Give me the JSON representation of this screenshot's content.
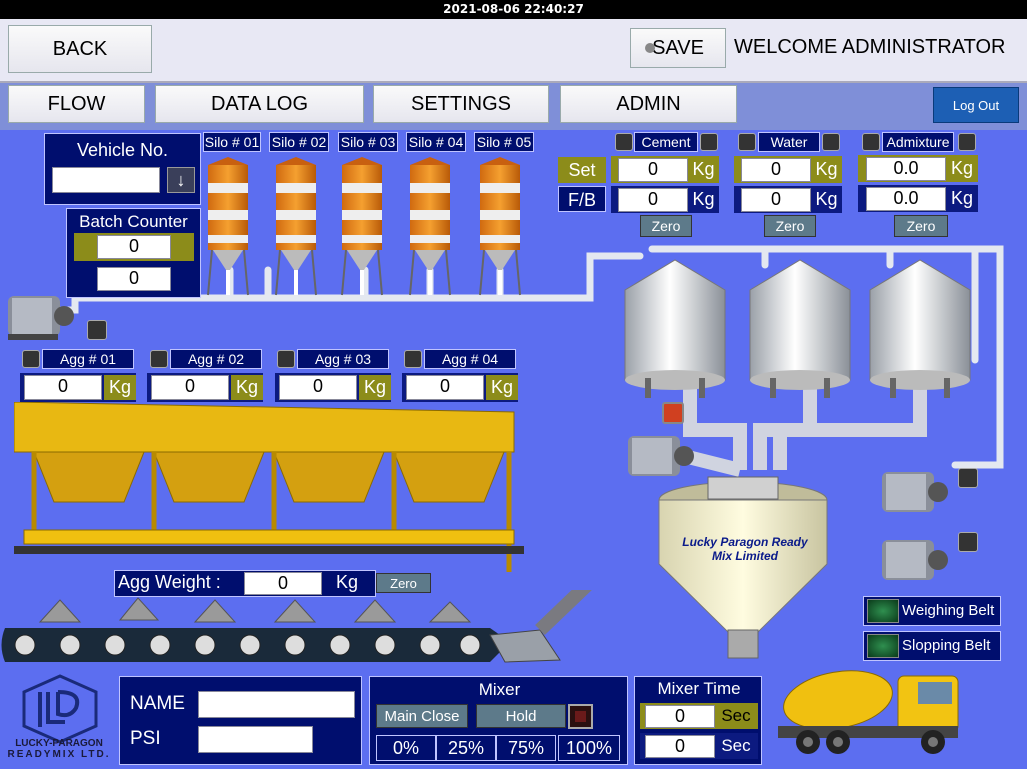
{
  "status_bar": {
    "datetime": "2021-08-06 22:40:27"
  },
  "header": {
    "back_label": "BACK",
    "save_label": "SAVE",
    "welcome_text": "WELCOME ADMINISTRATOR"
  },
  "nav": {
    "flow": "FLOW",
    "data_log": "DATA LOG",
    "settings": "SETTINGS",
    "admin": "ADMIN",
    "logout": "Log Out"
  },
  "vehicle": {
    "label": "Vehicle No.",
    "value": ""
  },
  "batch_counter": {
    "label": "Batch Counter",
    "set": "0",
    "actual": "0"
  },
  "silos": [
    "Silo # 01",
    "Silo # 02",
    "Silo # 03",
    "Silo # 04",
    "Silo # 05"
  ],
  "rows": {
    "set": "Set",
    "fb": "F/B"
  },
  "cement": {
    "label": "Cement",
    "set": "0",
    "fb": "0",
    "unit": "Kg",
    "zero": "Zero"
  },
  "water": {
    "label": "Water",
    "set": "0",
    "fb": "0",
    "unit": "Kg",
    "zero": "Zero"
  },
  "admixture": {
    "label": "Admixture",
    "set": "0.0",
    "fb": "0.0",
    "unit": "Kg",
    "zero": "Zero"
  },
  "aggregates": [
    {
      "label": "Agg # 01",
      "value": "0",
      "unit": "Kg"
    },
    {
      "label": "Agg # 02",
      "value": "0",
      "unit": "Kg"
    },
    {
      "label": "Agg # 03",
      "value": "0",
      "unit": "Kg"
    },
    {
      "label": "Agg # 04",
      "value": "0",
      "unit": "Kg"
    }
  ],
  "agg_weight": {
    "label": "Agg Weight :",
    "value": "0",
    "unit": "Kg",
    "zero": "Zero"
  },
  "mixer_brand": {
    "line1": "Lucky Paragon Ready",
    "line2": "Mix Limited"
  },
  "belts": {
    "weighing": "Weighing Belt",
    "slopping": "Slopping Belt"
  },
  "logo": {
    "line1": "LUCKY-PARAGON",
    "line2": "READYMIX LTD."
  },
  "form": {
    "name_label": "NAME",
    "psi_label": "PSI",
    "name_value": "",
    "psi_value": ""
  },
  "mixer": {
    "title": "Mixer",
    "main_close": "Main Close",
    "hold": "Hold",
    "percents": [
      "0%",
      "25%",
      "75%",
      "100%"
    ]
  },
  "mixer_time": {
    "title": "Mixer Time",
    "set": "0",
    "actual": "0",
    "unit": "Sec"
  },
  "colors": {
    "background": "#5c6ef0",
    "panel": "#000e6e",
    "accent_olive": "#8c8c1a",
    "alarm_red": "#d04020",
    "belt_green": "#1a6a3a"
  }
}
